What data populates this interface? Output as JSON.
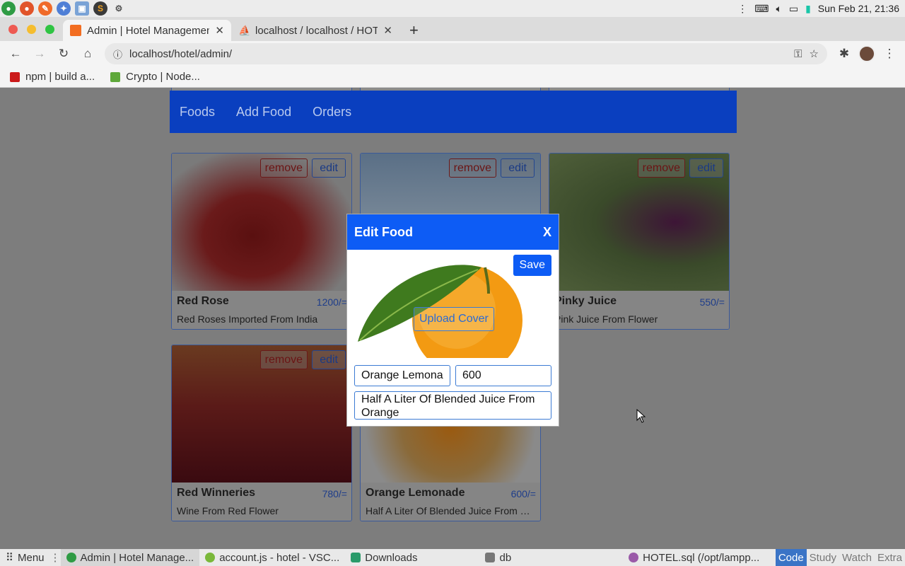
{
  "system": {
    "clock": "Sun Feb 21, 21:36",
    "launcher_icons": [
      "chrome-icon",
      "firefox-icon",
      "postman-icon",
      "vscode-icon",
      "virtualbox-icon",
      "sublime-icon",
      "settings-icon"
    ]
  },
  "browser": {
    "tabs": [
      {
        "title": "Admin | Hotel Management",
        "active": true
      },
      {
        "title": "localhost / localhost / HOTEL",
        "active": false
      }
    ],
    "url": "localhost/hotel/admin/",
    "bookmarks": [
      "npm | build a...",
      "Crypto | Node..."
    ]
  },
  "app": {
    "nav": [
      "Foods",
      "Add Food",
      "Orders"
    ],
    "remove_label": "remove",
    "edit_label": "edit",
    "foods": [
      {
        "name": "Red Rose",
        "price": "1200/=",
        "description": "Red Roses Imported From India"
      },
      {
        "name": "",
        "price": "",
        "description": ""
      },
      {
        "name": "Pinky Juice",
        "price": "550/=",
        "description": "Pink Juice From Flower"
      },
      {
        "name": "Red Winneries",
        "price": "780/=",
        "description": "Wine From Red Flower"
      },
      {
        "name": "Orange Lemonade",
        "price": "600/=",
        "description": "Half A Liter Of Blended Juice From Orange"
      }
    ]
  },
  "modal": {
    "title": "Edit Food",
    "close": "X",
    "save": "Save",
    "upload": "Upload Cover",
    "name_value": "Orange Lemona",
    "price_value": "600",
    "description_value": "Half A Liter Of Blended Juice From Orange"
  },
  "taskbar": {
    "menu": "Menu",
    "items": [
      "Admin | Hotel Manage...",
      "account.js - hotel - VSC...",
      "Downloads",
      "db",
      "HOTEL.sql (/opt/lampp..."
    ],
    "workspaces": [
      "Code",
      "Study",
      "Watch",
      "Extra"
    ],
    "active_workspace": "Code"
  },
  "colors": {
    "accent": "#0d5cf5",
    "nav": "#0a3fbf",
    "remove": "#6b1414"
  }
}
